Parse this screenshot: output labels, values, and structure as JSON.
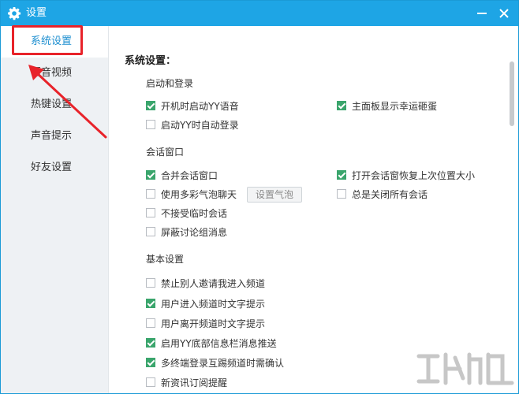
{
  "window": {
    "title": "设置"
  },
  "sidebar": {
    "items": [
      {
        "label": "系统设置"
      },
      {
        "label": "语音视频"
      },
      {
        "label": "热键设置"
      },
      {
        "label": "声音提示"
      },
      {
        "label": "好友设置"
      }
    ]
  },
  "content": {
    "section_title": "系统设置：",
    "groups": [
      {
        "title": "启动和登录",
        "options": [
          {
            "label": "开机时启动YY语音",
            "checked": true
          },
          {
            "label": "主面板显示幸运砸蛋",
            "checked": true
          },
          {
            "label": "启动YY时自动登录",
            "checked": false
          }
        ]
      },
      {
        "title": "会话窗口",
        "options": [
          {
            "label": "合并会话窗口",
            "checked": true
          },
          {
            "label": "打开会话窗恢复上次位置大小",
            "checked": true
          },
          {
            "label": "使用多彩气泡聊天",
            "checked": false
          },
          {
            "label": "总是关闭所有会话",
            "checked": false
          },
          {
            "label": "不接受临时会话",
            "checked": false
          },
          {
            "label": "屏蔽讨论组消息",
            "checked": false
          }
        ],
        "bubble_button": "设置气泡"
      },
      {
        "title": "基本设置",
        "options": [
          {
            "label": "禁止别人邀请我进入频道",
            "checked": false
          },
          {
            "label": "用户进入频道时文字提示",
            "checked": true
          },
          {
            "label": "用户离开频道时文字提示",
            "checked": false
          },
          {
            "label": "启用YY底部信息栏消息推送",
            "checked": true
          },
          {
            "label": "多终端登录互踢频道时需确认",
            "checked": true
          },
          {
            "label": "新资讯订阅提醒",
            "checked": false
          }
        ]
      }
    ]
  },
  "colors": {
    "titlebar": "#1ea5e5",
    "check": "#3aa56c",
    "highlight": "#e8232a",
    "active_text": "#1e8fd0"
  }
}
